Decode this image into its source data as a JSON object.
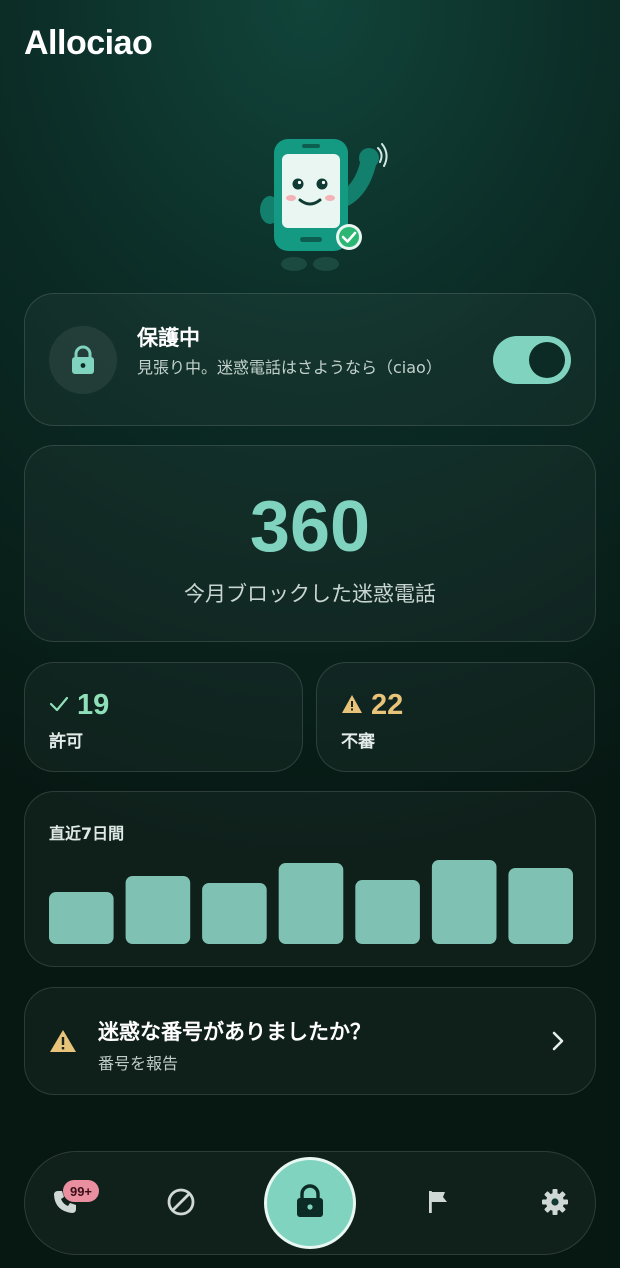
{
  "app": {
    "title": "Allociao"
  },
  "colors": {
    "accent": "#7fd3bf",
    "warning": "#e8c37a",
    "allowed": "#8fe0b8",
    "background": "#0b2a24"
  },
  "mascot": {
    "icon": "smiling-phone-mascot-waving-icon",
    "status_icon": "green-check-badge-icon"
  },
  "protection": {
    "icon": "lock-icon",
    "title": "保護中",
    "description": "見張り中。迷惑電話はさようなら（ciao）",
    "toggle_on": true
  },
  "blocked": {
    "count": "360",
    "label": "今月ブロックした迷惑電話"
  },
  "stats": {
    "allowed": {
      "icon": "check-icon",
      "count": "19",
      "label": "許可"
    },
    "suspicious": {
      "icon": "warning-triangle-icon",
      "count": "22",
      "label": "不審"
    }
  },
  "chart": {
    "title": "直近7日間"
  },
  "chart_data": {
    "type": "bar",
    "title": "直近7日間",
    "categories": [
      "",
      "",
      "",
      "",
      "",
      "",
      ""
    ],
    "values": [
      52,
      68,
      61,
      81,
      64,
      84,
      76
    ],
    "ylim": [
      0,
      92
    ],
    "grid": false,
    "color": "#7fc1b3"
  },
  "report": {
    "icon": "warning-triangle-icon",
    "title": "迷惑な番号がありましたか？",
    "subtitle": "番号を報告",
    "chevron": "chevron-right-icon"
  },
  "nav": {
    "calls": {
      "icon": "phone-icon",
      "badge": "99+"
    },
    "blocked": {
      "icon": "block-icon"
    },
    "protect": {
      "icon": "lock-icon"
    },
    "report": {
      "icon": "flag-icon"
    },
    "settings": {
      "icon": "gear-icon"
    }
  }
}
